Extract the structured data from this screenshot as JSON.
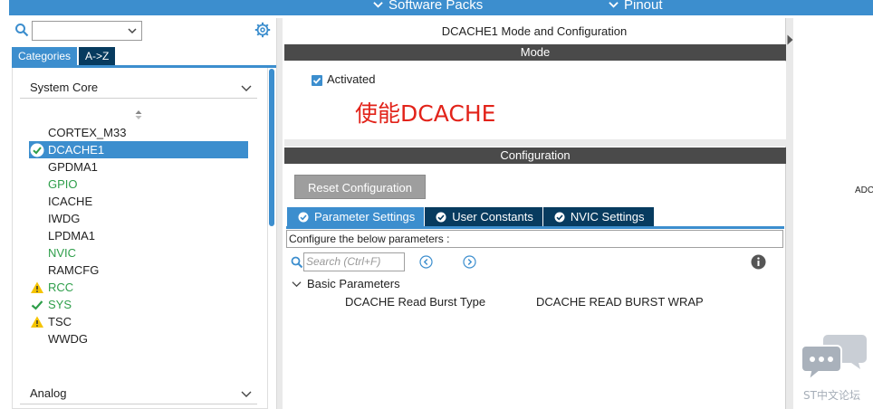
{
  "topbar": {
    "software_packs": "Software Packs",
    "pinout": "Pinout"
  },
  "left": {
    "search_placeholder": "",
    "tabs": [
      {
        "label": "Categories",
        "active": true
      },
      {
        "label": "A->Z",
        "active": false
      }
    ],
    "categories": [
      {
        "label": "System Core",
        "items": [
          {
            "label": "CORTEX_M33",
            "status": "none",
            "selected": false,
            "color": "default"
          },
          {
            "label": "DCACHE1",
            "status": "check-circle",
            "selected": true,
            "color": "default"
          },
          {
            "label": "GPDMA1",
            "status": "none",
            "selected": false,
            "color": "default"
          },
          {
            "label": "GPIO",
            "status": "none",
            "selected": false,
            "color": "green"
          },
          {
            "label": "ICACHE",
            "status": "none",
            "selected": false,
            "color": "default"
          },
          {
            "label": "IWDG",
            "status": "none",
            "selected": false,
            "color": "default"
          },
          {
            "label": "LPDMA1",
            "status": "none",
            "selected": false,
            "color": "default"
          },
          {
            "label": "NVIC",
            "status": "none",
            "selected": false,
            "color": "green"
          },
          {
            "label": "RAMCFG",
            "status": "none",
            "selected": false,
            "color": "default"
          },
          {
            "label": "RCC",
            "status": "warning",
            "selected": false,
            "color": "green"
          },
          {
            "label": "SYS",
            "status": "check",
            "selected": false,
            "color": "green"
          },
          {
            "label": "TSC",
            "status": "warning",
            "selected": false,
            "color": "default"
          },
          {
            "label": "WWDG",
            "status": "none",
            "selected": false,
            "color": "default"
          }
        ]
      },
      {
        "label": "Analog",
        "items": []
      }
    ]
  },
  "center": {
    "title": "DCACHE1 Mode and Configuration",
    "mode_header": "Mode",
    "activated_label": "Activated",
    "activated_checked": true,
    "annotation": "使能DCACHE",
    "config_header": "Configuration",
    "reset_button": "Reset Configuration",
    "param_tabs": [
      {
        "label": "Parameter Settings",
        "active": true
      },
      {
        "label": "User Constants",
        "active": false
      },
      {
        "label": "NVIC Settings",
        "active": false
      }
    ],
    "configure_text": "Configure the below parameters :",
    "search_placeholder": "Search (Ctrl+F)",
    "group_label": "Basic Parameters",
    "params": [
      {
        "name": "DCACHE Read Burst Type",
        "value": "DCACHE READ BURST WRAP"
      }
    ]
  },
  "right": {
    "adc_label": "ADC",
    "watermark_text": "ST中文论坛"
  },
  "colors": {
    "accent": "#3c8ece",
    "dark_tab": "#073b5f",
    "section_bar": "#4a4a4a",
    "annotation_red": "#e2231a",
    "green_text": "#2e9e4a",
    "warning": "#f5c400"
  }
}
